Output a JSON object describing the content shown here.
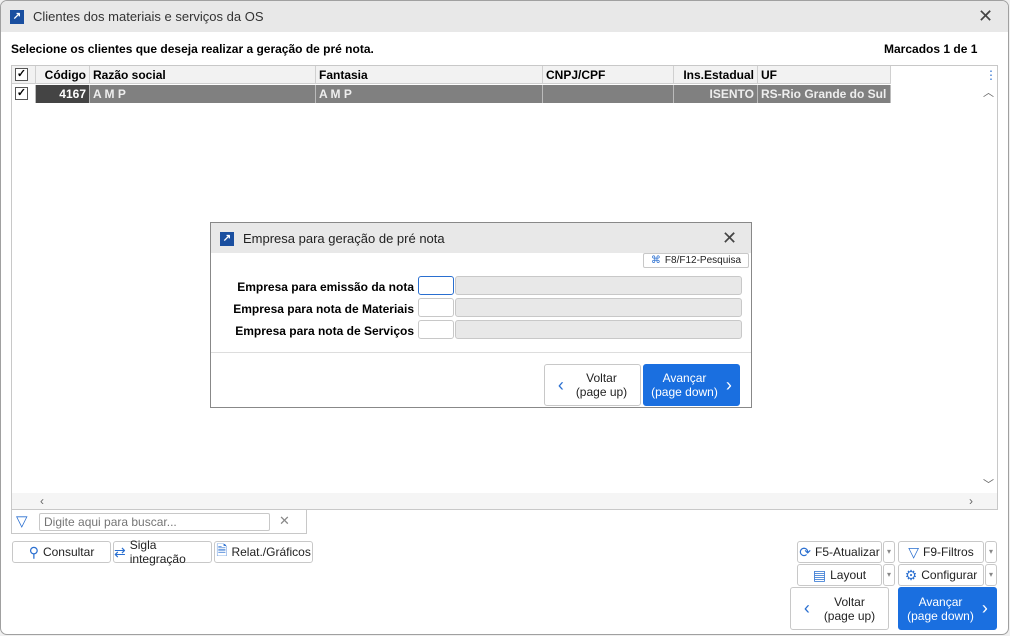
{
  "window": {
    "title": "Clientes dos materiais e serviços da OS",
    "instruction": "Selecione os clientes que deseja realizar a geração de pré nota.",
    "marked": "Marcados 1 de 1"
  },
  "grid": {
    "columns": [
      "Código",
      "Razão social",
      "Fantasia",
      "CNPJ/CPF",
      "Ins.Estadual",
      "UF"
    ],
    "rows": [
      {
        "checked": true,
        "codigo": "4167",
        "razao": "A M P",
        "fantasia": "A M P",
        "cnpj": "",
        "ie": "ISENTO",
        "uf": "RS-Rio Grande do Sul"
      }
    ]
  },
  "search": {
    "placeholder": "Digite aqui para buscar..."
  },
  "buttons": {
    "consultar": "Consultar",
    "sigla": "Sigla integração",
    "relat": "Relat./Gráficos",
    "atualizar": "F5-Atualizar",
    "filtros": "F9-Filtros",
    "layout": "Layout",
    "configurar": "Configurar",
    "voltar": "Voltar",
    "voltar_sub": "(page up)",
    "avancar": "Avançar",
    "avancar_sub": "(page down)"
  },
  "modal": {
    "title": "Empresa para geração de pré nota",
    "pesquisa": "F8/F12-Pesquisa",
    "fields": [
      {
        "label": "Empresa para emissão da nota",
        "code": "",
        "name": ""
      },
      {
        "label": "Empresa para nota de Materiais",
        "code": "",
        "name": ""
      },
      {
        "label": "Empresa para nota de Serviços",
        "code": "",
        "name": ""
      }
    ],
    "voltar": "Voltar",
    "voltar_sub": "(page up)",
    "avancar": "Avançar",
    "avancar_sub": "(page down)"
  },
  "colors": {
    "accent": "#1a6fe0",
    "selected_row": "#808080"
  }
}
